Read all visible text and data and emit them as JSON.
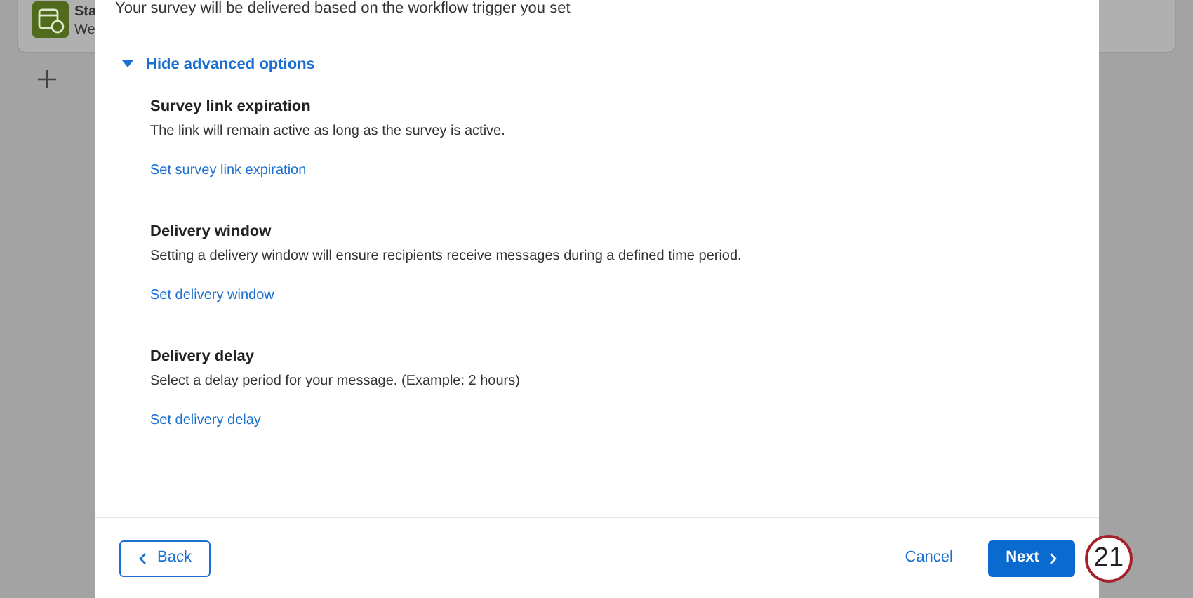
{
  "background_card": {
    "title": "Sta",
    "subtitle": "We"
  },
  "modal": {
    "intro": "Your survey will be delivered based on the workflow trigger you set",
    "advanced_toggle": {
      "label": "Hide advanced options",
      "expanded": true
    },
    "sections": [
      {
        "title": "Survey link expiration",
        "description": "The link will remain active as long as the survey is active.",
        "link": "Set survey link expiration"
      },
      {
        "title": "Delivery window",
        "description": "Setting a delivery window will ensure recipients receive messages during a defined time period.",
        "link": "Set delivery window"
      },
      {
        "title": "Delivery delay",
        "description": "Select a delay period for your message. (Example: 2 hours)",
        "link": "Set delivery delay"
      }
    ],
    "footer": {
      "back": "Back",
      "cancel": "Cancel",
      "next": "Next"
    }
  },
  "step_badge": "21"
}
